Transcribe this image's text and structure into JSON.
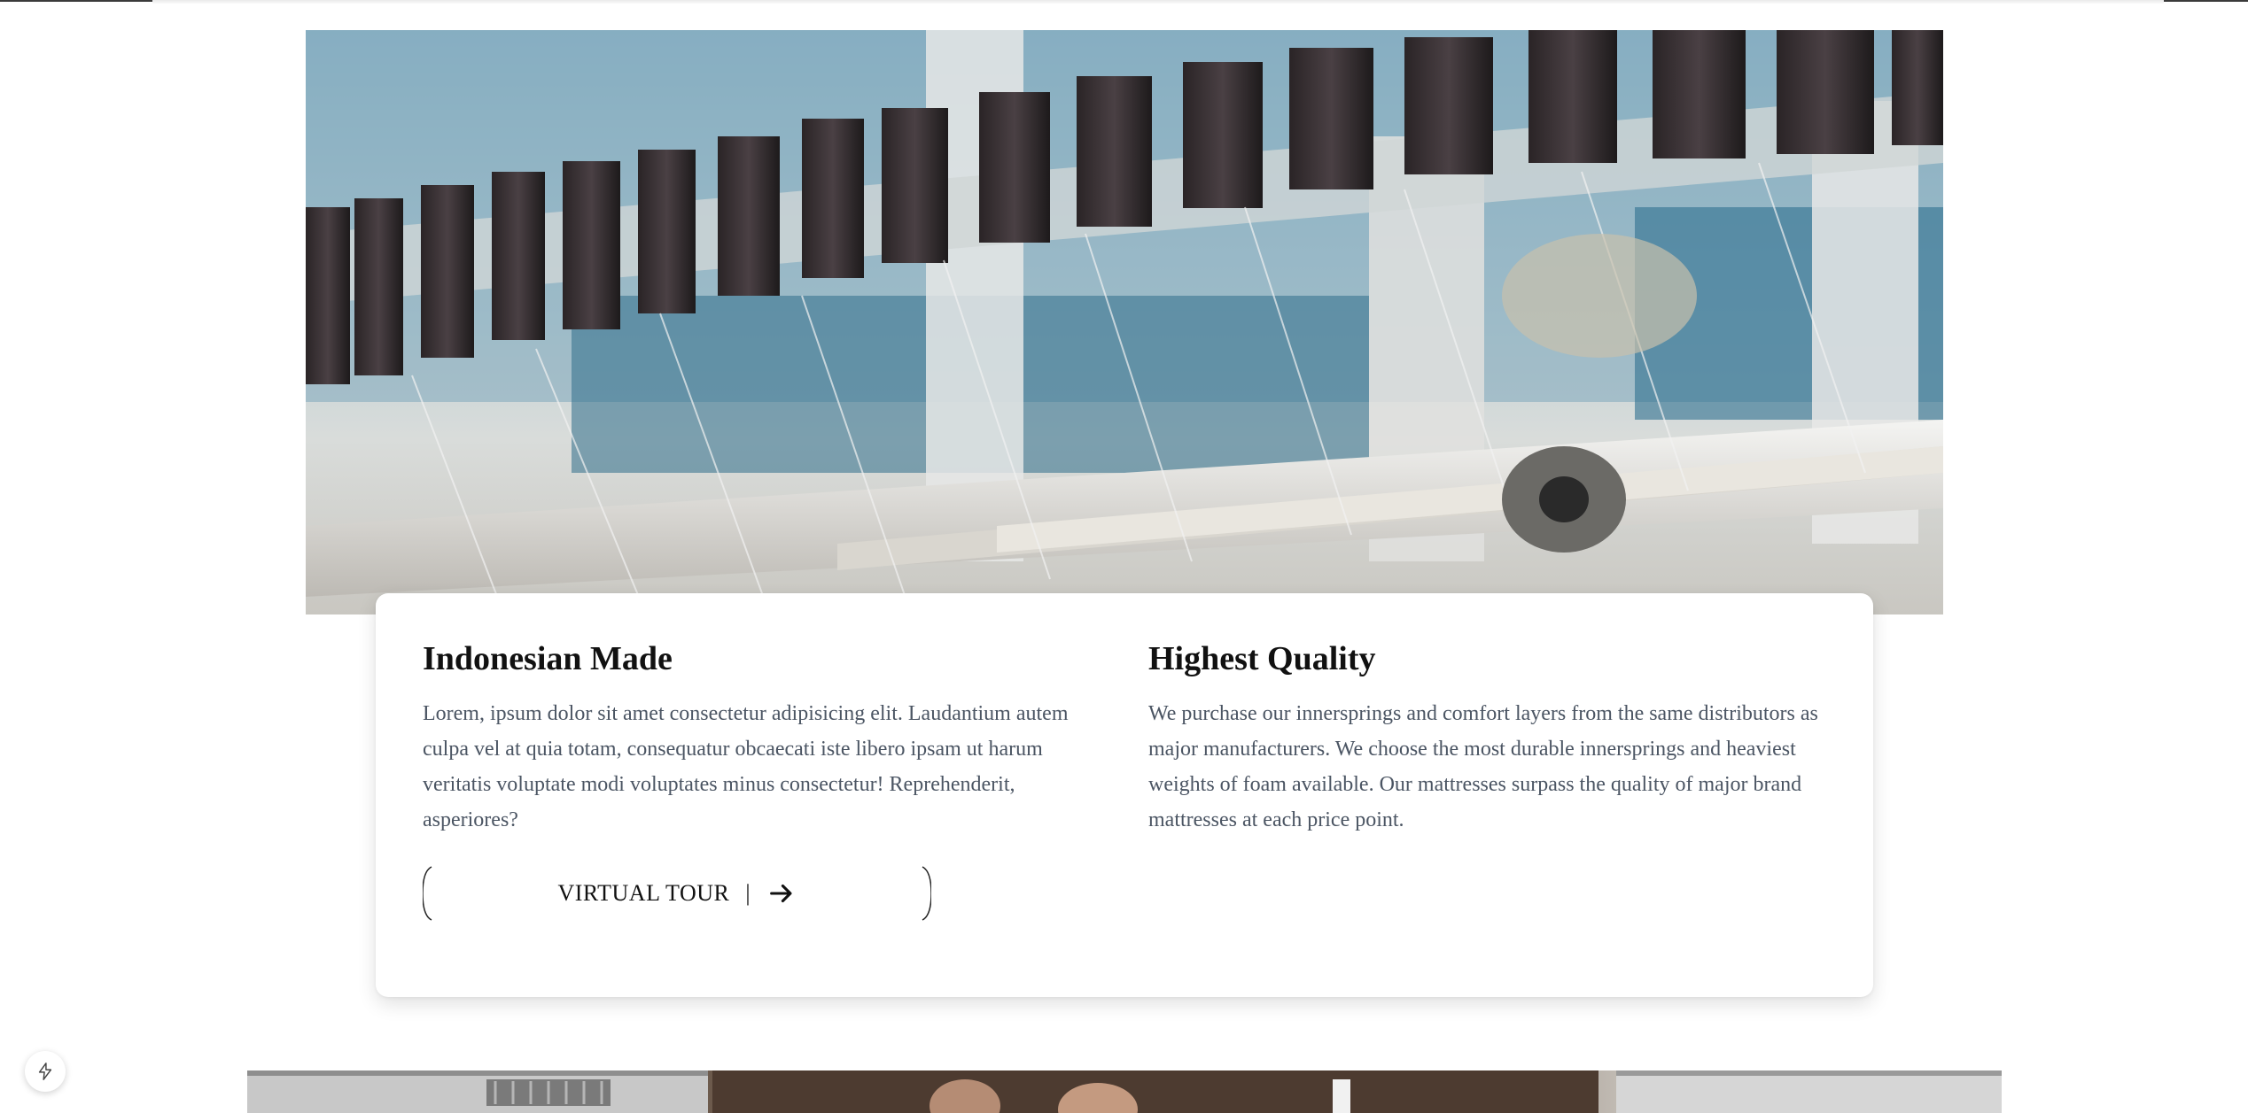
{
  "hero": {
    "image_subject": "industrial loom machine"
  },
  "features": [
    {
      "title": "Indonesian Made",
      "body": "Lorem, ipsum dolor sit amet consectetur adipisicing elit. Laudantium autem culpa vel at quia totam, consequatur obcaecati iste libero ipsam ut harum veritatis voluptate modi voluptates minus consectetur! Reprehenderit, asperiores?"
    },
    {
      "title": "Highest Quality",
      "body": "We purchase our innersprings and comfort layers from the same distributors as major manufacturers. We choose the most durable innersprings and heaviest weights of foam available. Our mattresses surpass the quality of major brand mattresses at each price point."
    }
  ],
  "cta": {
    "label": "VIRTUAL TOUR",
    "separator": "|",
    "icon": "arrow-right-icon"
  },
  "floating_button": {
    "icon": "bolt-icon"
  },
  "colors": {
    "heading": "#111111",
    "body_text": "#4b5563",
    "card_bg": "#ffffff"
  }
}
